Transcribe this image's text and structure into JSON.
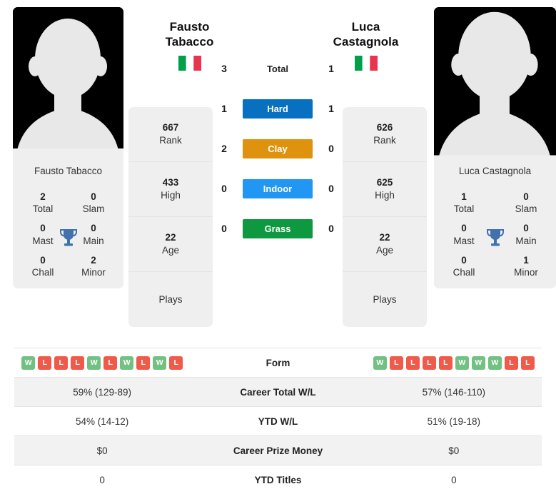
{
  "players": {
    "left": {
      "first_name": "Fausto",
      "last_name": "Tabacco",
      "full_name": "Fausto Tabacco",
      "country": "Italy",
      "flag": "it",
      "titles": {
        "total_value": "2",
        "total_label": "Total",
        "slam_value": "0",
        "slam_label": "Slam",
        "mast_value": "0",
        "mast_label": "Mast",
        "main_value": "0",
        "main_label": "Main",
        "chall_value": "0",
        "chall_label": "Chall",
        "minor_value": "2",
        "minor_label": "Minor"
      },
      "info": {
        "rank_value": "667",
        "rank_label": "Rank",
        "high_value": "433",
        "high_label": "High",
        "age_value": "22",
        "age_label": "Age",
        "plays_value": "",
        "plays_label": "Plays"
      },
      "form": [
        "W",
        "L",
        "L",
        "L",
        "W",
        "L",
        "W",
        "L",
        "W",
        "L"
      ],
      "career_wl": "59% (129-89)",
      "ytd_wl": "54% (14-12)",
      "career_prize": "$0",
      "ytd_titles": "0"
    },
    "right": {
      "first_name": "Luca",
      "last_name": "Castagnola",
      "full_name": "Luca Castagnola",
      "country": "Italy",
      "flag": "it",
      "titles": {
        "total_value": "1",
        "total_label": "Total",
        "slam_value": "0",
        "slam_label": "Slam",
        "mast_value": "0",
        "mast_label": "Mast",
        "main_value": "0",
        "main_label": "Main",
        "chall_value": "0",
        "chall_label": "Chall",
        "minor_value": "1",
        "minor_label": "Minor"
      },
      "info": {
        "rank_value": "626",
        "rank_label": "Rank",
        "high_value": "625",
        "high_label": "High",
        "age_value": "22",
        "age_label": "Age",
        "plays_value": "",
        "plays_label": "Plays"
      },
      "form": [
        "W",
        "L",
        "L",
        "L",
        "L",
        "W",
        "W",
        "W",
        "L",
        "L"
      ],
      "career_wl": "57% (146-110)",
      "ytd_wl": "51% (19-18)",
      "career_prize": "$0",
      "ytd_titles": "0"
    }
  },
  "head_to_head": {
    "rows": [
      {
        "label": "Total",
        "left": "3",
        "right": "1",
        "color": ""
      },
      {
        "label": "Hard",
        "left": "1",
        "right": "1",
        "color": "#0770c0"
      },
      {
        "label": "Clay",
        "left": "2",
        "right": "0",
        "color": "#df920d"
      },
      {
        "label": "Indoor",
        "left": "0",
        "right": "0",
        "color": "#2196f3"
      },
      {
        "label": "Grass",
        "left": "0",
        "right": "0",
        "color": "#0e9940"
      }
    ]
  },
  "stats_table": {
    "rows": [
      {
        "label": "Form",
        "type": "form"
      },
      {
        "label": "Career Total W/L",
        "type": "text",
        "left_key": "career_wl",
        "right_key": "career_wl"
      },
      {
        "label": "YTD W/L",
        "type": "text",
        "left_key": "ytd_wl",
        "right_key": "ytd_wl"
      },
      {
        "label": "Career Prize Money",
        "type": "text",
        "left_key": "career_prize",
        "right_key": "career_prize"
      },
      {
        "label": "YTD Titles",
        "type": "text",
        "left_key": "ytd_titles",
        "right_key": "ytd_titles"
      }
    ]
  },
  "colors": {
    "hard": "#0770c0",
    "clay": "#df920d",
    "indoor": "#2196f3",
    "grass": "#0e9940",
    "win_badge": "#72c183",
    "loss_badge": "#ef5a4a",
    "trophy": "#4272ad",
    "card_bg": "#efefef",
    "flag_green": "#00a04a",
    "flag_red": "#e8344e"
  }
}
